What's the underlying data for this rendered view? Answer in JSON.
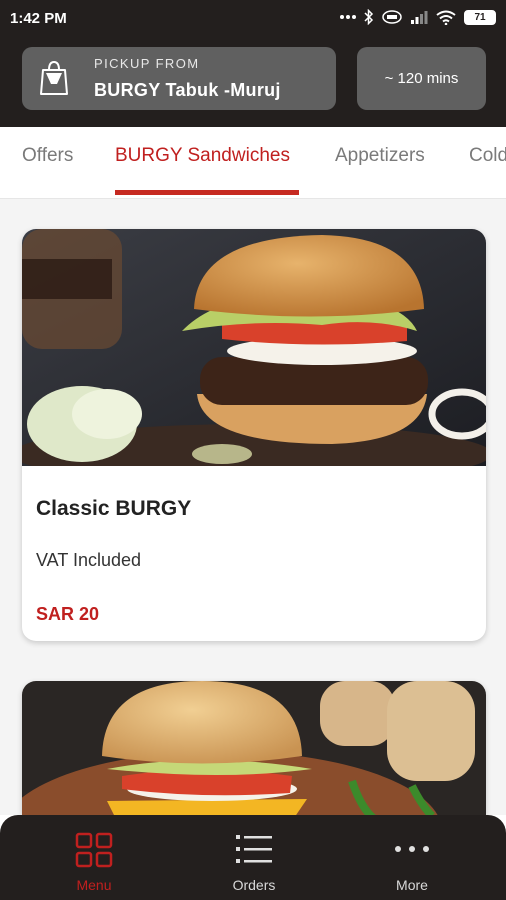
{
  "status_bar": {
    "time": "1:42 PM",
    "battery": "71"
  },
  "pickup": {
    "label": "PICKUP FROM",
    "store": "BURGY Tabuk -Muruj",
    "time_estimate": "~ 120 mins"
  },
  "tabs": [
    {
      "label": "Offers",
      "active": false
    },
    {
      "label": "BURGY Sandwiches",
      "active": true
    },
    {
      "label": "Appetizers",
      "active": false
    },
    {
      "label": "Cold",
      "active": false
    }
  ],
  "products": [
    {
      "name": "Classic BURGY",
      "vat": "VAT Included",
      "price": "SAR 20"
    }
  ],
  "bottom_nav": [
    {
      "label": "Menu",
      "icon": "grid-icon",
      "active": true
    },
    {
      "label": "Orders",
      "icon": "list-icon",
      "active": false
    },
    {
      "label": "More",
      "icon": "more-dots-icon",
      "active": false
    }
  ],
  "colors": {
    "header_bg": "#231f1e",
    "accent": "#c0201f",
    "card_bg": "#606060"
  }
}
